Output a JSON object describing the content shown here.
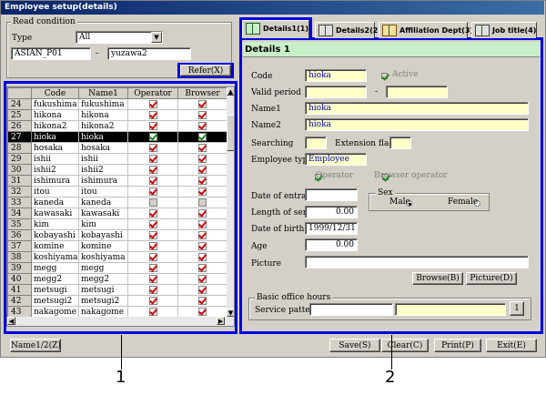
{
  "window": {
    "title": "Employee setup(details)"
  },
  "read_condition": {
    "group_label": "Read condition",
    "type_label": "Type",
    "type_value": "All",
    "from_value": "ASIAN_P01",
    "separator": "-",
    "to_value": "yuzawa2",
    "refer_button": "Refer(X)"
  },
  "grid": {
    "columns": [
      "Code",
      "Name1",
      "Operator",
      "Browser"
    ],
    "rows": [
      {
        "num": "24",
        "code": "fukushima",
        "name": "fukushima",
        "op": true,
        "br": true
      },
      {
        "num": "25",
        "code": "hikona",
        "name": "hikona",
        "op": true,
        "br": true
      },
      {
        "num": "26",
        "code": "hikona2",
        "name": "hikona2",
        "op": true,
        "br": true
      },
      {
        "num": "27",
        "code": "hioka",
        "name": "hioka",
        "op": true,
        "br": true,
        "selected": true
      },
      {
        "num": "28",
        "code": "hosaka",
        "name": "hosaka",
        "op": true,
        "br": true
      },
      {
        "num": "29",
        "code": "ishii",
        "name": "ishii",
        "op": true,
        "br": true
      },
      {
        "num": "30",
        "code": "ishii2",
        "name": "ishii2",
        "op": true,
        "br": true
      },
      {
        "num": "31",
        "code": "ishimura",
        "name": "ishimura",
        "op": true,
        "br": true
      },
      {
        "num": "32",
        "code": "itou",
        "name": "itou",
        "op": true,
        "br": true
      },
      {
        "num": "33",
        "code": "kaneda",
        "name": "kaneda",
        "op": false,
        "br": false
      },
      {
        "num": "34",
        "code": "kawasaki",
        "name": "kawasaki",
        "op": true,
        "br": true
      },
      {
        "num": "35",
        "code": "kim",
        "name": "kim",
        "op": true,
        "br": true
      },
      {
        "num": "36",
        "code": "kobayashi",
        "name": "kobayashi",
        "op": true,
        "br": true
      },
      {
        "num": "37",
        "code": "komine",
        "name": "komine",
        "op": true,
        "br": true
      },
      {
        "num": "38",
        "code": "koshiyama",
        "name": "koshiyama",
        "op": true,
        "br": true
      },
      {
        "num": "39",
        "code": "megg",
        "name": "megg",
        "op": true,
        "br": true
      },
      {
        "num": "40",
        "code": "megg2",
        "name": "megg2",
        "op": true,
        "br": true
      },
      {
        "num": "41",
        "code": "metsugi",
        "name": "metsugi",
        "op": true,
        "br": true
      },
      {
        "num": "42",
        "code": "metsugi2",
        "name": "metsugi2",
        "op": true,
        "br": true
      },
      {
        "num": "43",
        "code": "nakagome",
        "name": "nakagome",
        "op": true,
        "br": true
      }
    ]
  },
  "tabs": [
    "Details1(1)",
    "Details2(2)",
    "Affiliation Dept(3)",
    "Job title(4)"
  ],
  "details": {
    "header": "Details 1",
    "code_label": "Code",
    "code_value": "hioka",
    "active_label": "Active",
    "valid_label": "Valid period",
    "valid_sep": "-",
    "name1_label": "Name1",
    "name1_value": "hioka",
    "name2_label": "Name2",
    "name2_value": "hioka",
    "searching_label": "Searching",
    "extension_label": "Extension flag",
    "emp_type_label": "Employee type",
    "emp_type_value": "Employee",
    "operator_label": "Operator",
    "browser_op_label": "Browser operator",
    "entrance_label": "Date of entrance",
    "sex_label": "Sex",
    "male_label": "Male",
    "female_label": "Female",
    "service_label": "Length of service",
    "service_value": "0.00",
    "birth_label": "Date of birth",
    "birth_value": "1999/12/31",
    "age_label": "Age",
    "age_value": "0.00",
    "picture_label": "Picture",
    "browse_button": "Browse(B)",
    "picture_button": "Picture(D)",
    "office_group": "Basic office hours",
    "pattern_label": "Service pattern",
    "pattern_btn": "1"
  },
  "bottom": {
    "name_button": "Name1/2(Z)",
    "save_button": "Save(S)",
    "clear_button": "Clear(C)",
    "print_button": "Print(P)",
    "exit_button": "Exit(E)"
  },
  "callouts": {
    "left": "1",
    "right": "2"
  },
  "colors": {
    "highlight": "#0000e0",
    "title_bar": "#0a246a",
    "field_yellow": "#ffffc8"
  }
}
